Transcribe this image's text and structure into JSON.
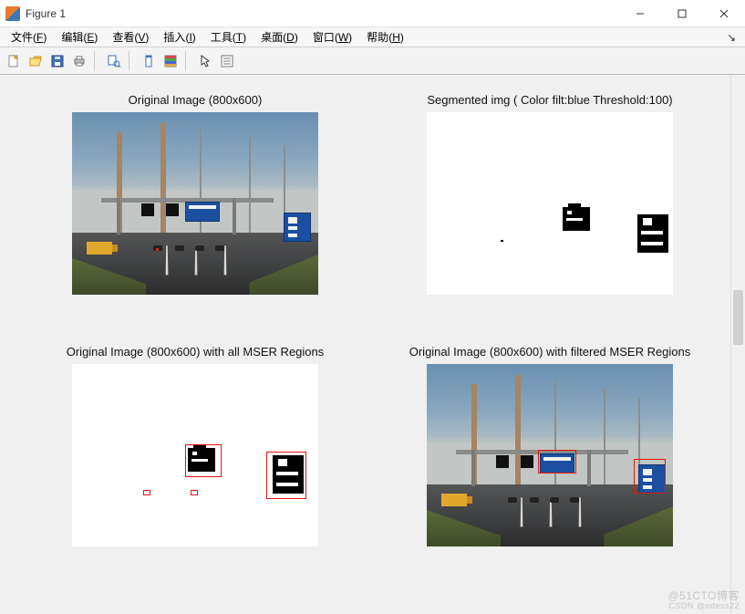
{
  "window": {
    "title": "Figure 1"
  },
  "menu": {
    "file": {
      "label": "文件",
      "accel": "F"
    },
    "edit": {
      "label": "编辑",
      "accel": "E"
    },
    "view": {
      "label": "查看",
      "accel": "V"
    },
    "insert": {
      "label": "插入",
      "accel": "I"
    },
    "tools": {
      "label": "工具",
      "accel": "T"
    },
    "desktop": {
      "label": "桌面",
      "accel": "D"
    },
    "window": {
      "label": "窗口",
      "accel": "W"
    },
    "help": {
      "label": "帮助",
      "accel": "H"
    },
    "tail": "↘"
  },
  "toolbar": {
    "icons": {
      "new": "new-file-icon",
      "open": "open-folder-icon",
      "save": "save-icon",
      "print": "print-icon",
      "datacursor": "data-cursor-icon",
      "link": "link-axes-icon",
      "colorbar": "colorbar-icon",
      "legend": "legend-icon",
      "pointer": "pointer-icon",
      "propeditor": "property-editor-icon"
    }
  },
  "subplots": {
    "s1": {
      "title": "Original Image (800x600)"
    },
    "s2": {
      "title": "Segmented img ( Color filt:blue Threshold:100)"
    },
    "s3": {
      "title": "Original Image (800x600) with all MSER Regions"
    },
    "s4": {
      "title": "Original Image (800x600) with filtered MSER Regions"
    }
  },
  "watermark": {
    "line1": "@51CTO博客",
    "line2": "CSDN @odess22"
  }
}
